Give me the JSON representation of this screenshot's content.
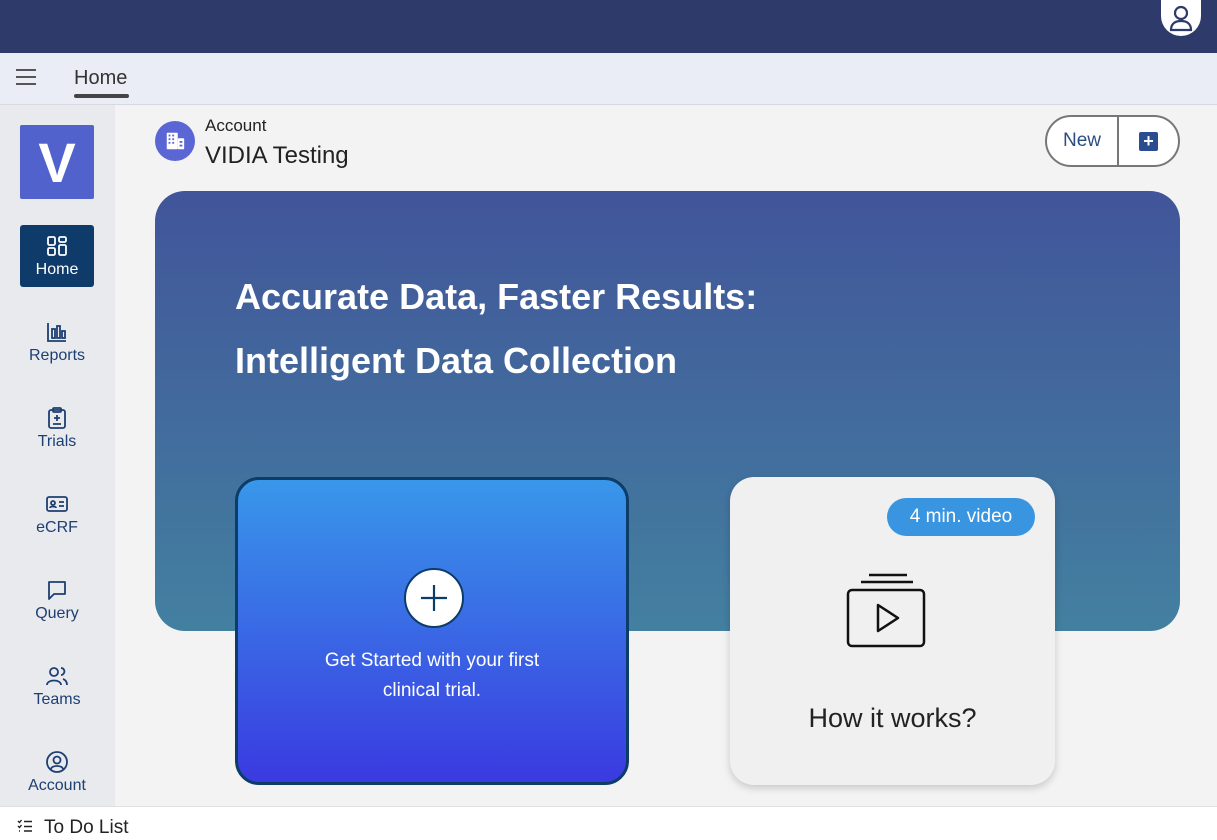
{
  "header": {
    "user_icon": "user-icon"
  },
  "tabs": {
    "menu_icon": "hamburger-icon",
    "active_tab": "Home"
  },
  "sidebar": {
    "logo": "V",
    "items": [
      {
        "label": "Home",
        "icon": "dashboard-icon",
        "active": true
      },
      {
        "label": "Reports",
        "icon": "bar-chart-icon"
      },
      {
        "label": "Trials",
        "icon": "clipboard-icon"
      },
      {
        "label": "eCRF",
        "icon": "id-card-icon"
      },
      {
        "label": "Query",
        "icon": "chat-icon"
      },
      {
        "label": "Teams",
        "icon": "people-icon"
      },
      {
        "label": "Account",
        "icon": "account-circle-icon"
      }
    ]
  },
  "account": {
    "label": "Account",
    "name": "VIDIA Testing",
    "icon": "building-icon"
  },
  "new_button": {
    "label": "New",
    "icon": "plus-square-icon"
  },
  "hero": {
    "line1": "Accurate Data, Faster Results:",
    "line2": "Intelligent Data Collection"
  },
  "get_started": {
    "line1": "Get Started with your first",
    "line2": "clinical trial.",
    "icon": "plus-circle-icon"
  },
  "video": {
    "badge": "4 min. video",
    "caption": "How it works?",
    "icon": "video-library-icon"
  },
  "todo": {
    "label": "To Do List",
    "icon": "checklist-icon"
  },
  "colors": {
    "topbar": "#2e3a6a",
    "accent": "#5262cc",
    "active_nav": "#0e3b6a"
  }
}
